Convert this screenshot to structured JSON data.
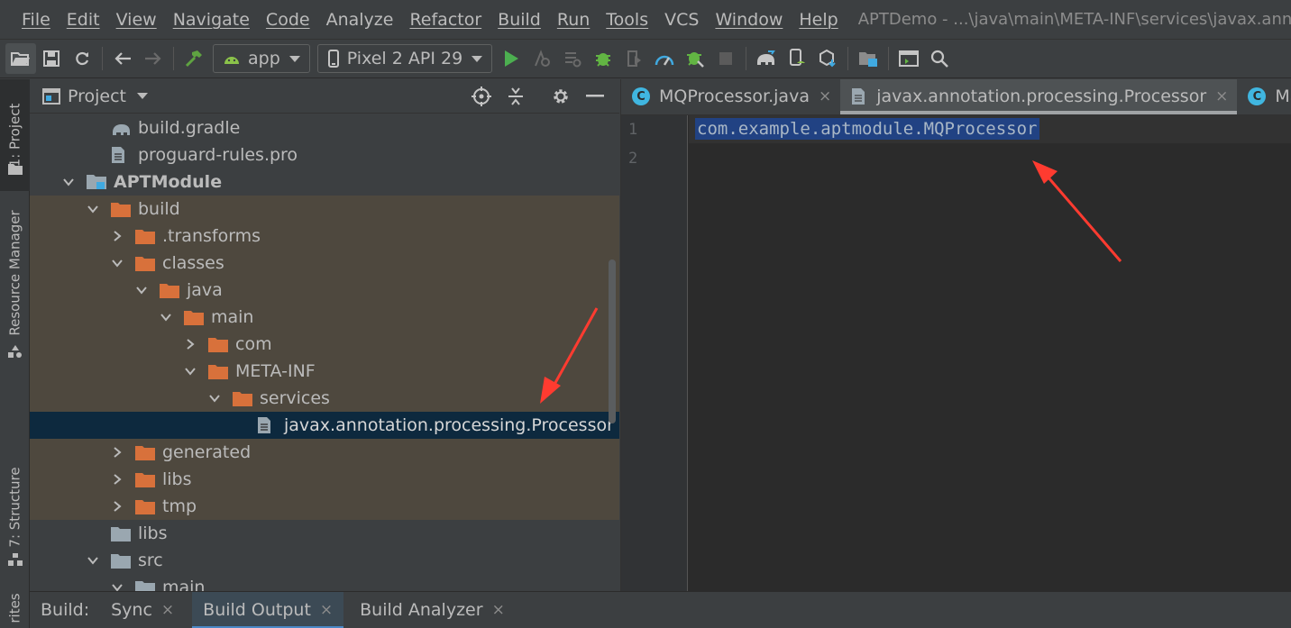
{
  "menubar": {
    "items": [
      "File",
      "Edit",
      "View",
      "Navigate",
      "Code",
      "Analyze",
      "Refactor",
      "Build",
      "Run",
      "Tools",
      "VCS",
      "Window",
      "Help"
    ],
    "window_title": "APTDemo - ...\\java\\main\\META-INF\\services\\javax.annot"
  },
  "toolbar": {
    "run_config": "app",
    "device": "Pixel 2 API 29"
  },
  "leftstrip": {
    "project_tab": "1: Project",
    "resource_tab": "Resource Manager",
    "structure_tab": "7: Structure",
    "favorites_tab": "rites"
  },
  "project": {
    "title": "Project",
    "tree": [
      {
        "label": "build.gradle",
        "depth": 3,
        "arrow": "none",
        "icon": "gradle-icon",
        "row": "normal"
      },
      {
        "label": "proguard-rules.pro",
        "depth": 3,
        "arrow": "none",
        "icon": "file-icon",
        "row": "normal"
      },
      {
        "label": "APTModule",
        "depth": 2,
        "arrow": "down",
        "icon": "module-icon",
        "row": "normal",
        "bold": true
      },
      {
        "label": "build",
        "depth": 3,
        "arrow": "down",
        "icon": "folder-orange",
        "row": "excl"
      },
      {
        "label": ".transforms",
        "depth": 4,
        "arrow": "right",
        "icon": "folder-orange",
        "row": "excl"
      },
      {
        "label": "classes",
        "depth": 4,
        "arrow": "down",
        "icon": "folder-orange",
        "row": "excl"
      },
      {
        "label": "java",
        "depth": 5,
        "arrow": "down",
        "icon": "folder-orange",
        "row": "excl"
      },
      {
        "label": "main",
        "depth": 6,
        "arrow": "down",
        "icon": "folder-orange",
        "row": "excl"
      },
      {
        "label": "com",
        "depth": 7,
        "arrow": "right",
        "icon": "folder-orange",
        "row": "excl"
      },
      {
        "label": "META-INF",
        "depth": 7,
        "arrow": "down",
        "icon": "folder-orange",
        "row": "excl"
      },
      {
        "label": "services",
        "depth": 8,
        "arrow": "down",
        "icon": "folder-orange",
        "row": "excl"
      },
      {
        "label": "javax.annotation.processing.Processor",
        "depth": 9,
        "arrow": "none",
        "icon": "file-icon",
        "row": "sel"
      },
      {
        "label": "generated",
        "depth": 4,
        "arrow": "right",
        "icon": "folder-orange",
        "row": "excl"
      },
      {
        "label": "libs",
        "depth": 4,
        "arrow": "right",
        "icon": "folder-orange",
        "row": "excl"
      },
      {
        "label": "tmp",
        "depth": 4,
        "arrow": "right",
        "icon": "folder-orange",
        "row": "excl"
      },
      {
        "label": "libs",
        "depth": 3,
        "arrow": "none",
        "icon": "folder-grey",
        "row": "normal"
      },
      {
        "label": "src",
        "depth": 3,
        "arrow": "down",
        "icon": "folder-grey",
        "row": "normal"
      },
      {
        "label": "main",
        "depth": 4,
        "arrow": "down",
        "icon": "folder-grey",
        "row": "normal"
      }
    ]
  },
  "editor": {
    "tabs": [
      {
        "label": "MQProcessor.java",
        "icon": "class-icon",
        "active": false,
        "close": "×"
      },
      {
        "label": "javax.annotation.processing.Processor",
        "icon": "file-icon",
        "active": true,
        "close": "×"
      },
      {
        "label": "MainAct",
        "icon": "class-icon",
        "active": false,
        "close": ""
      }
    ],
    "line_numbers": [
      "1",
      "2"
    ],
    "code_line_1": "com.example.aptmodule.MQProcessor"
  },
  "bottom": {
    "build_label": "Build:",
    "tabs": [
      {
        "label": "Sync",
        "active": false
      },
      {
        "label": "Build Output",
        "active": true
      },
      {
        "label": "Build Analyzer",
        "active": false
      }
    ],
    "close_glyph": "×"
  },
  "colors": {
    "accent_red": "#ff3b30",
    "excluded_bg": "#4e483e",
    "selected_bg": "#0d293e",
    "selection_hl": "#214283",
    "folder_orange": "#d8713b",
    "run_green": "#4caf50"
  }
}
